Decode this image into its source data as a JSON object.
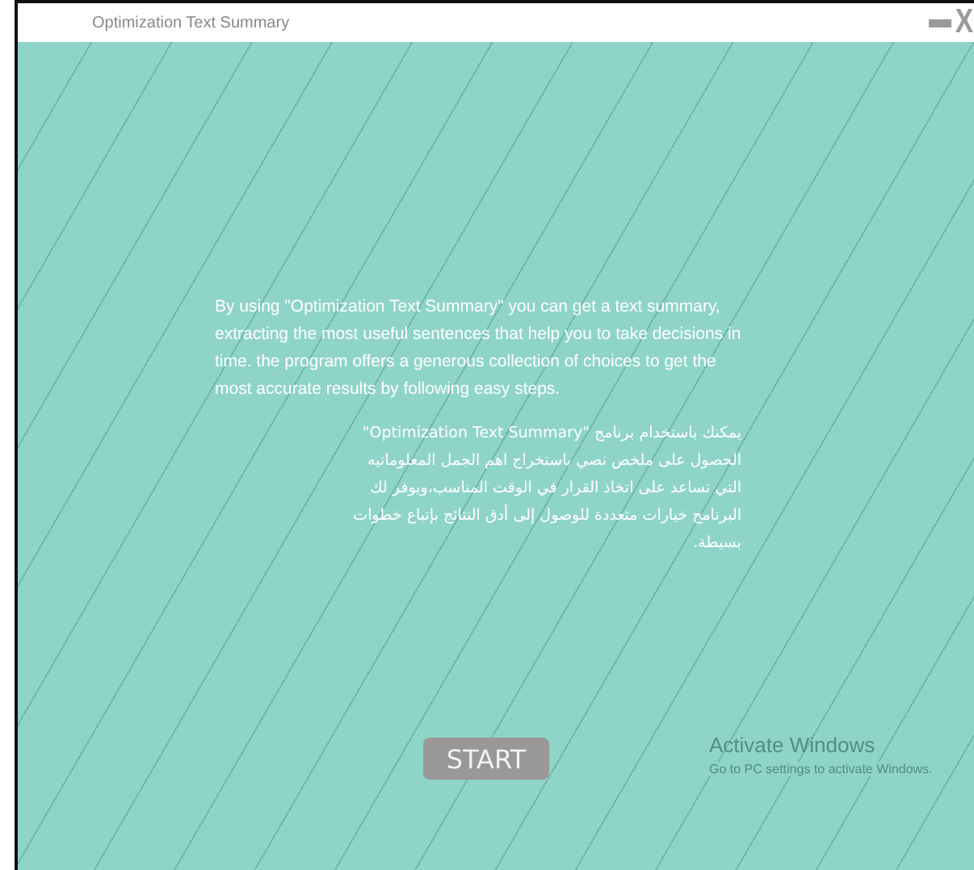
{
  "window": {
    "title": "Optimization Text Summary",
    "close_label": "X"
  },
  "intro_en": "By using \"Optimization Text Summary\" you can get a text summary, extracting the most useful sentences that help you to take decisions in time. the program offers a generous collection of choices to get the most accurate results by following easy steps.",
  "intro_ar": "يمكنك باستخدام برنامج \"Optimization Text Summary\" الحصول على ملخص نصي باستخراج اهم الجمل المعلوماتيه التي تساعد على اتخاذ القرار في الوقت المناسب،ويوفر لك البرنامج خيارات متعددة للوصول إلى أدق النتائج بإتباع خطوات بسيطة.",
  "start_button": "START",
  "os_notice": {
    "title": "Activate Windows",
    "text": "Go to PC settings to activate Windows."
  }
}
